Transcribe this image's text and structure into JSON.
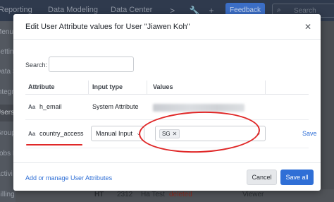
{
  "background": {
    "topnav": {
      "links": [
        "Reporting",
        "Data Modeling",
        "Data Center"
      ],
      "feedback_label": "Feedback",
      "search_placeholder": "Search",
      "icons": [
        "terminal-icon",
        "wrench-icon",
        "plus-icon",
        "search-icon"
      ]
    },
    "leftnav": {
      "items": [
        "Menu",
        "Setting",
        "Data S",
        "Integr",
        "Users",
        "Group",
        "Jobs M",
        "Activi",
        "Billing"
      ]
    },
    "table_row": {
      "code": "HT",
      "id": "2312",
      "name": "Ha Test",
      "status": "deleted",
      "role": "Viewer"
    }
  },
  "modal": {
    "title": "Edit User Attribute values for User \"Jiawen Koh\"",
    "search": {
      "label": "Search:",
      "value": "",
      "placeholder": ""
    },
    "columns": [
      "Attribute",
      "Input type",
      "Values"
    ],
    "rows": [
      {
        "icon": "Aa",
        "attribute": "h_email",
        "input_type": "System Attribute",
        "value_redacted": true
      },
      {
        "icon": "Aa",
        "attribute": "country_access",
        "input_type": "Manual Input",
        "values": [
          "SG"
        ],
        "save_label": "Save"
      }
    ],
    "footer": {
      "link": "Add or manage User Attributes",
      "cancel_label": "Cancel",
      "save_all_label": "Save all"
    }
  },
  "annotation_color": "#e02828",
  "accent_color": "#2f6fd6"
}
